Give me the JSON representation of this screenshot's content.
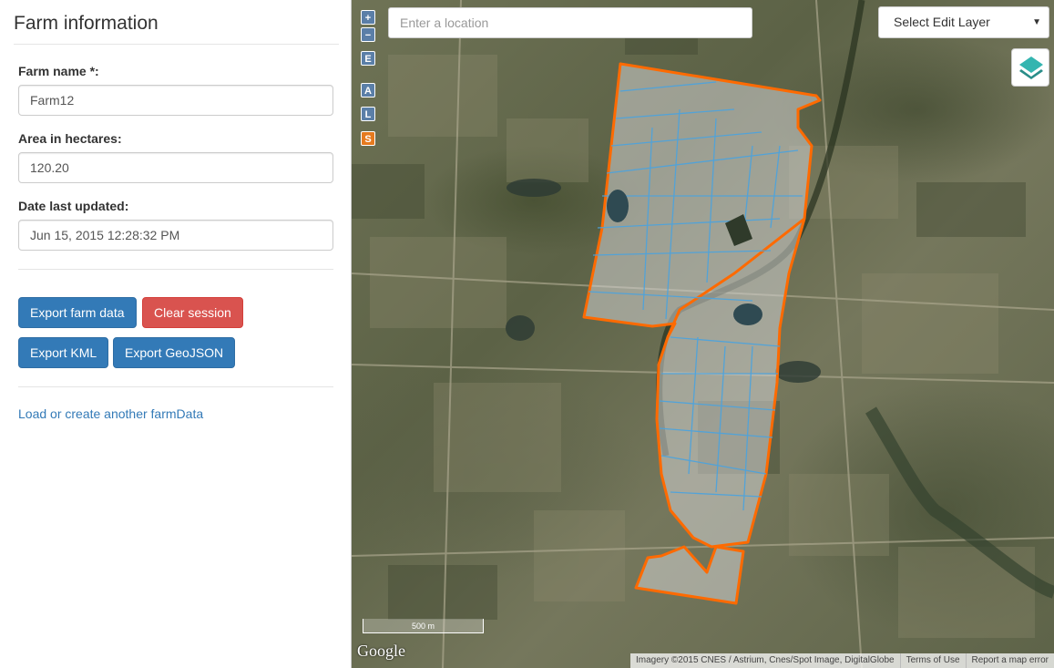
{
  "sidebar": {
    "title": "Farm information",
    "farm_name_label": "Farm name *:",
    "farm_name_value": "Farm12",
    "area_label": "Area in hectares:",
    "area_value": "120.20",
    "date_label": "Date last updated:",
    "date_value": "Jun 15, 2015 12:28:32 PM",
    "buttons": {
      "export_farm": "Export farm data",
      "clear_session": "Clear session",
      "export_kml": "Export KML",
      "export_geojson": "Export GeoJSON"
    },
    "load_link": "Load or create another farmData"
  },
  "map": {
    "controls": {
      "zoom_in": "+",
      "zoom_out": "−",
      "edit": "E",
      "a": "A",
      "l": "L",
      "s": "S"
    },
    "location_placeholder": "Enter a location",
    "select_layer": "Select Edit Layer",
    "select_arrow": "▼",
    "scale_label": "500 m",
    "logo": "Google",
    "attribution": {
      "imagery": "Imagery ©2015 CNES / Astrium, Cnes/Spot Image, DigitalGlobe",
      "terms": "Terms of Use",
      "report": "Report a map error"
    },
    "colors": {
      "farm_outline": "#ff6a00",
      "paddock_outline": "#4aa3df",
      "control_blue": "#5b7fa8",
      "control_orange": "#e57a1f"
    }
  }
}
